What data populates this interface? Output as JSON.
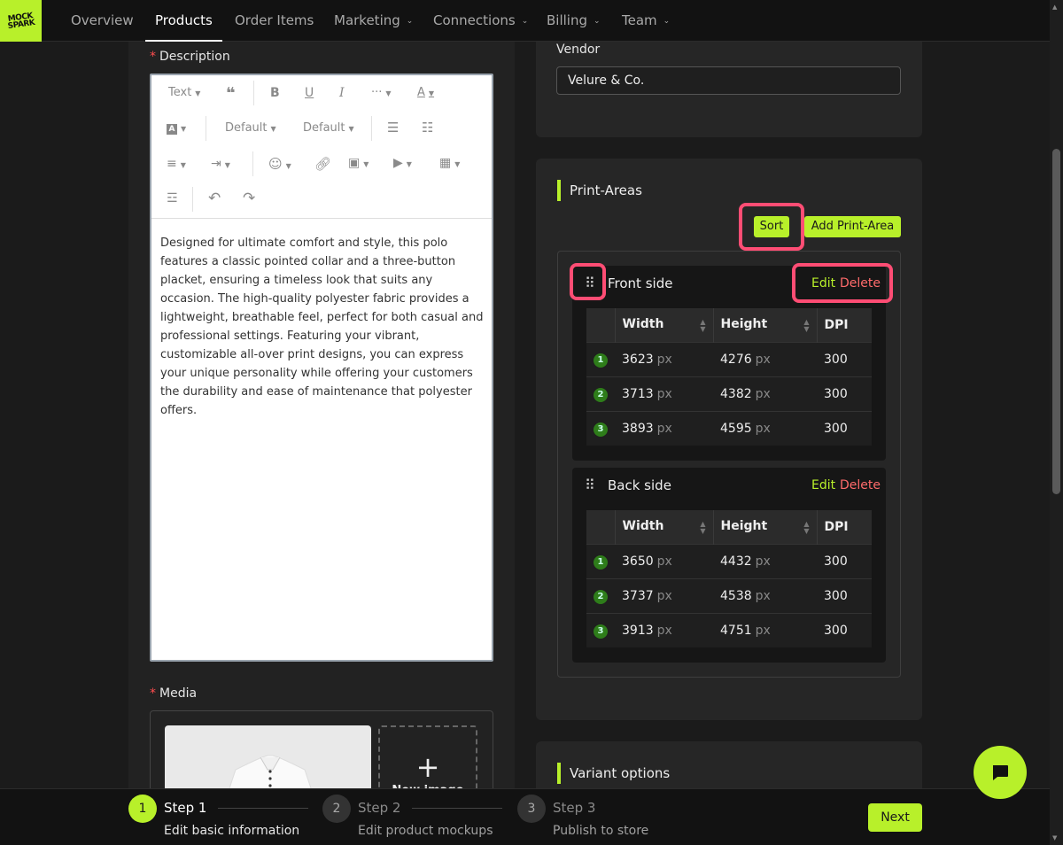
{
  "nav": {
    "logo_text": "MOCK SPARK",
    "items": [
      {
        "label": "Overview"
      },
      {
        "label": "Products"
      },
      {
        "label": "Order Items"
      },
      {
        "label": "Marketing"
      },
      {
        "label": "Connections"
      },
      {
        "label": "Billing"
      },
      {
        "label": "Team"
      }
    ]
  },
  "description": {
    "label": "Description",
    "toolbar": {
      "text_style": "Text",
      "font_family": "Default",
      "font_size": "Default"
    },
    "body": "Designed for ultimate comfort and style, this polo features a classic pointed collar and a three-button placket, ensuring a timeless look that suits any occasion. The high-quality polyester fabric provides a lightweight, breathable feel, perfect for both casual and professional settings. Featuring your vibrant, customizable all-over print designs, you can express your unique personality while offering your customers the durability and ease of maintenance that polyester offers."
  },
  "media": {
    "label": "Media",
    "new_image_label": "New image"
  },
  "vendor": {
    "label": "Vendor",
    "value": "Velure & Co."
  },
  "print_areas": {
    "title": "Print-Areas",
    "sort_label": "Sort",
    "add_label": "Add Print-Area",
    "edit_label": "Edit",
    "delete_label": "Delete",
    "columns": {
      "width": "Width",
      "height": "Height",
      "dpi": "DPI"
    },
    "unit": "px",
    "areas": [
      {
        "name": "Front side",
        "rows": [
          {
            "n": "1",
            "width": "3623",
            "height": "4276",
            "dpi": "300"
          },
          {
            "n": "2",
            "width": "3713",
            "height": "4382",
            "dpi": "300"
          },
          {
            "n": "3",
            "width": "3893",
            "height": "4595",
            "dpi": "300"
          }
        ]
      },
      {
        "name": "Back side",
        "rows": [
          {
            "n": "1",
            "width": "3650",
            "height": "4432",
            "dpi": "300"
          },
          {
            "n": "2",
            "width": "3737",
            "height": "4538",
            "dpi": "300"
          },
          {
            "n": "3",
            "width": "3913",
            "height": "4751",
            "dpi": "300"
          }
        ]
      }
    ]
  },
  "variant_options": {
    "title": "Variant options"
  },
  "steps": [
    {
      "n": "1",
      "title": "Step 1",
      "desc": "Edit basic information"
    },
    {
      "n": "2",
      "title": "Step 2",
      "desc": "Edit product mockups"
    },
    {
      "n": "3",
      "title": "Step 3",
      "desc": "Publish to store"
    }
  ],
  "next_label": "Next",
  "colors": {
    "accent": "#b8f02a",
    "danger": "#ff6b6b",
    "highlight": "#ff4d74"
  }
}
